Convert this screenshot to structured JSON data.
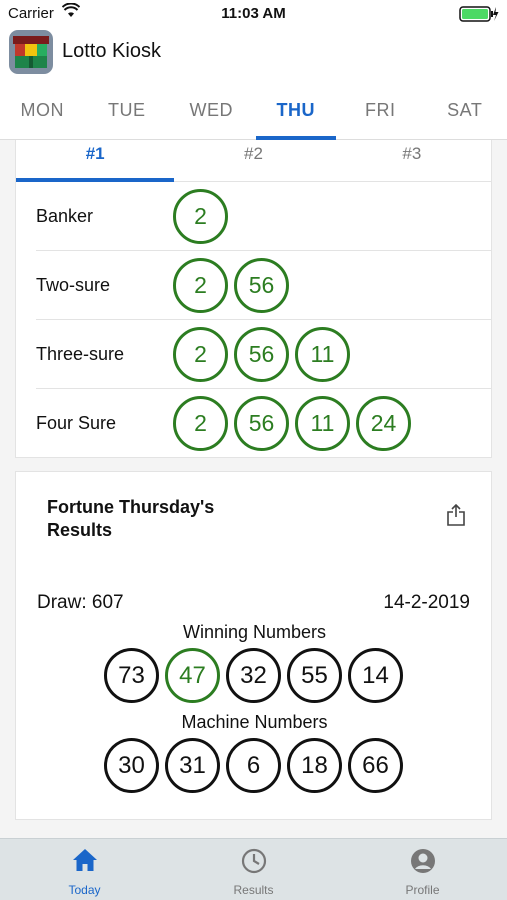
{
  "status": {
    "carrier": "Carrier",
    "time": "11:03 AM"
  },
  "app": {
    "title": "Lotto Kiosk"
  },
  "days": [
    "MON",
    "TUE",
    "WED",
    "THU",
    "FRI",
    "SAT"
  ],
  "active_day": "THU",
  "subtabs": [
    "#1",
    "#2",
    "#3"
  ],
  "predictions": [
    {
      "label": "Banker",
      "numbers": [
        "2"
      ]
    },
    {
      "label": "Two-sure",
      "numbers": [
        "2",
        "56"
      ]
    },
    {
      "label": "Three-sure",
      "numbers": [
        "2",
        "56",
        "11"
      ]
    },
    {
      "label": "Four Sure",
      "numbers": [
        "2",
        "56",
        "11",
        "24"
      ]
    }
  ],
  "results": {
    "title": "Fortune Thursday's Results",
    "draw": "Draw: 607",
    "date": "14-2-2019",
    "winning_label": "Winning Numbers",
    "winning": [
      "73",
      "47",
      "32",
      "55",
      "14"
    ],
    "highlighted": "47",
    "machine_label": "Machine Numbers",
    "machine": [
      "30",
      "31",
      "6",
      "18",
      "66"
    ]
  },
  "nav": {
    "today": "Today",
    "results": "Results",
    "profile": "Profile"
  },
  "colors": {
    "accent": "#1a66c9",
    "green": "#2c7d21"
  }
}
